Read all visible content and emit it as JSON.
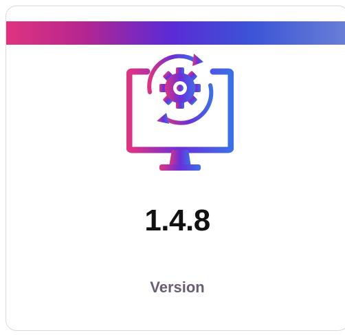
{
  "card": {
    "icon": "monitor-settings-update-icon",
    "value": "1.4.8",
    "label": "Version"
  },
  "colors": {
    "gradient_start": "#e0337f",
    "gradient_mid": "#5b2ad6",
    "gradient_end": "#3b6fe8",
    "label_color": "#6a5d74"
  }
}
